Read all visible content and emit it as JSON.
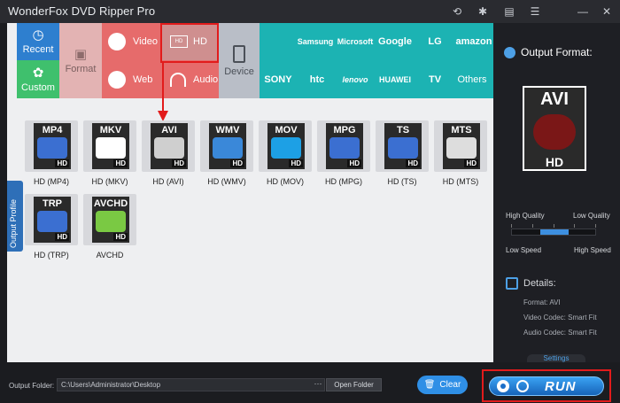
{
  "app": {
    "title": "WonderFox DVD Ripper Pro"
  },
  "categories": {
    "recent": "Recent",
    "custom": "Custom",
    "format": "Format",
    "video": "Video",
    "web": "Web",
    "hd": "HD",
    "audio": "Audio",
    "device": "Device"
  },
  "brands": [
    "Samsung",
    "Microsoft",
    "Google",
    "LG",
    "amazon",
    "SONY",
    "htc",
    "lenovo",
    "HUAWEI",
    "TV",
    "Others"
  ],
  "side_tab": {
    "label": "Output Profile"
  },
  "formats": [
    {
      "badge": "MP4",
      "label": "HD (MP4)",
      "color": "#3b6fd1"
    },
    {
      "badge": "MKV",
      "label": "HD (MKV)",
      "color": "#ffffff"
    },
    {
      "badge": "AVI",
      "label": "HD (AVI)",
      "color": "#cfcfcf"
    },
    {
      "badge": "WMV",
      "label": "HD (WMV)",
      "color": "#3a88d9"
    },
    {
      "badge": "MOV",
      "label": "HD (MOV)",
      "color": "#1da0e5"
    },
    {
      "badge": "MPG",
      "label": "HD (MPG)",
      "color": "#3b6fd1"
    },
    {
      "badge": "TS",
      "label": "HD (TS)",
      "color": "#3b6fd1"
    },
    {
      "badge": "MTS",
      "label": "HD (MTS)",
      "color": "#dddddd"
    },
    {
      "badge": "TRP",
      "label": "HD (TRP)",
      "color": "#3b6fd1"
    },
    {
      "badge": "AVCHD",
      "label": "AVCHD",
      "color": "#7ac943"
    }
  ],
  "output": {
    "title": "Output Format:",
    "format_badge": "AVI",
    "format_hd": "HD",
    "high_quality": "High Quality",
    "low_quality": "Low Quality",
    "low_speed": "Low Speed",
    "high_speed": "High Speed",
    "details_title": "Details:",
    "format_line": "Format: AVI",
    "video_codec": "Video Codec: Smart Fit",
    "audio_codec": "Audio Codec: Smart Fit",
    "settings": "Settings"
  },
  "bottom": {
    "output_folder_label": "Output Folder:",
    "output_folder_value": "C:\\Users\\Administrator\\Desktop",
    "browse": "···",
    "open_folder": "Open Folder",
    "clear": "Clear",
    "run": "RUN"
  },
  "colors": {
    "teal": "#1cb3b3",
    "red_tile": "#e66b6b",
    "green_tile": "#3fc06d",
    "recent_blue": "#2e7fcf",
    "format_grey": "#e0b8b8",
    "device_grey": "#b9bec7",
    "accent_blue": "#2f8fe6",
    "highlight_red": "#e21b1b"
  }
}
